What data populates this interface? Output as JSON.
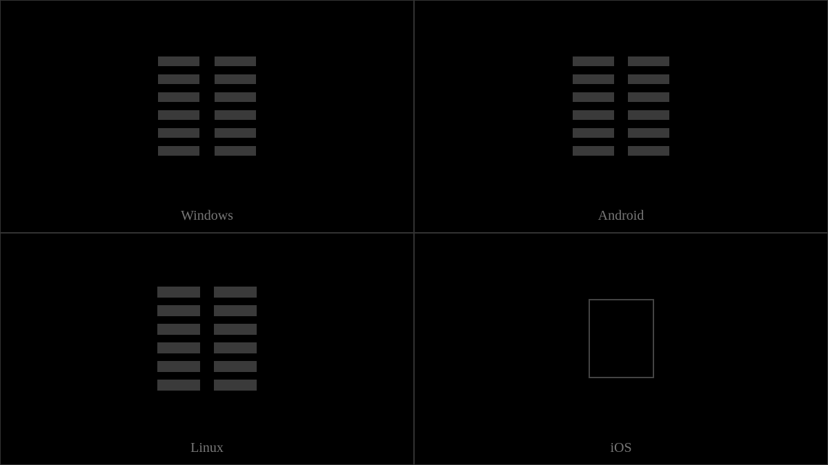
{
  "cells": [
    {
      "platform": "Windows",
      "glyphType": "hexagram",
      "variant": "windows"
    },
    {
      "platform": "Android",
      "glyphType": "hexagram",
      "variant": "android"
    },
    {
      "platform": "Linux",
      "glyphType": "hexagram",
      "variant": "linux"
    },
    {
      "platform": "iOS",
      "glyphType": "missing",
      "variant": "ios"
    }
  ],
  "glyph": {
    "name": "hexagram-kun",
    "unicodeName": "Hexagram for The Receptive Earth",
    "description": "Six broken horizontal lines (yin lines)"
  }
}
